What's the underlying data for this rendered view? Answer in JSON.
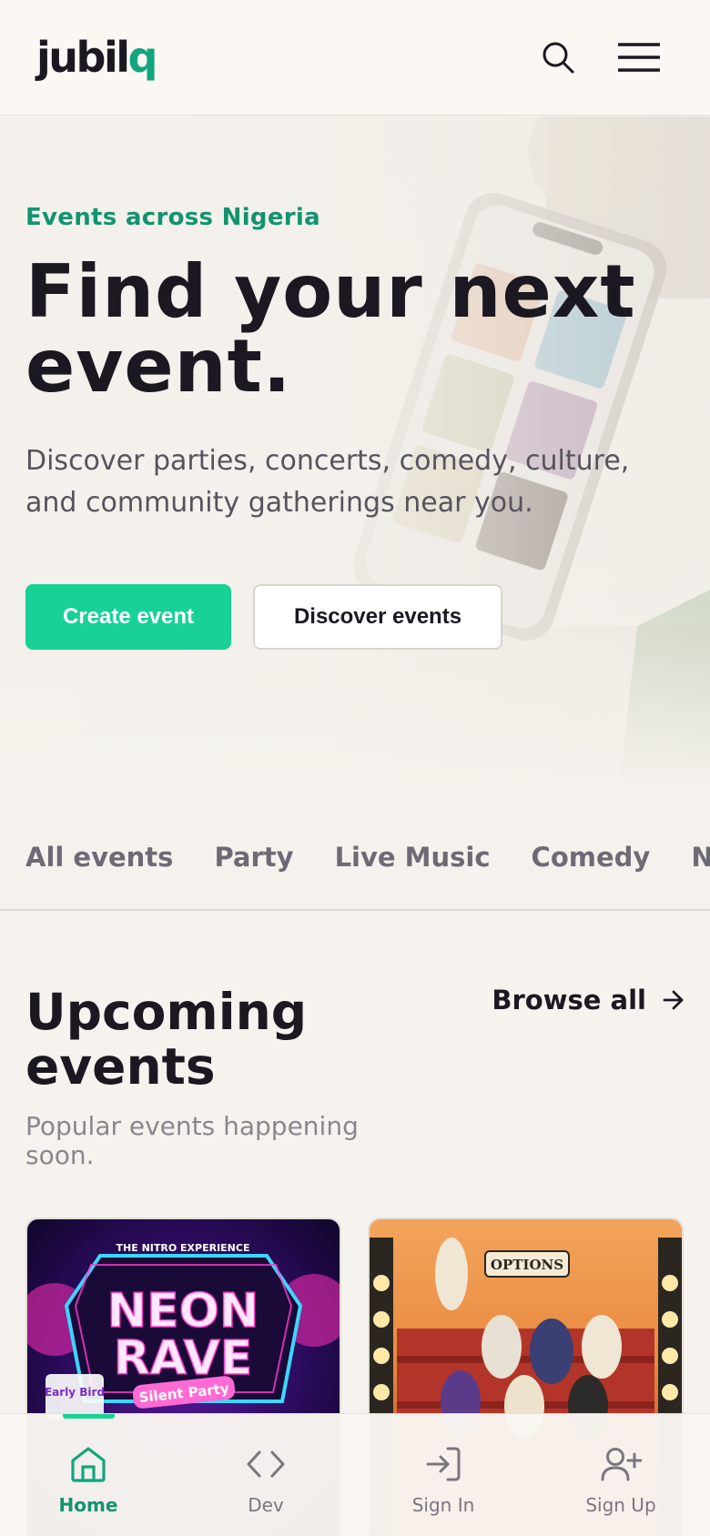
{
  "header": {
    "logo_main": "jubil",
    "logo_accent": "q",
    "search_icon": "search-icon",
    "menu_icon": "hamburger-menu-icon"
  },
  "hero": {
    "eyebrow": "Events across Nigeria",
    "title": "Find your next event.",
    "subtitle": "Discover parties, concerts, comedy, culture, and community gatherings near you.",
    "primary_button": "Create event",
    "secondary_button": "Discover events"
  },
  "categories": {
    "items": [
      "All events",
      "Party",
      "Live Music",
      "Comedy",
      "Nightlife"
    ]
  },
  "upcoming": {
    "title": "Upcoming events",
    "subtitle": "Popular events happening soon.",
    "browse_label": "Browse all",
    "cards": [
      {
        "poster_brand": "THE NITRO EXPERIENCE",
        "poster_title_line1": "NEON",
        "poster_title_line2": "RAVE",
        "poster_tag": "Silent Party",
        "poster_badge": "Early Bird"
      },
      {
        "poster_brand": "OPTIONS"
      }
    ]
  },
  "bottom_nav": {
    "items": [
      {
        "label": "Home",
        "icon": "home-icon",
        "active": true
      },
      {
        "label": "Dev",
        "icon": "code-icon",
        "active": false
      },
      {
        "label": "Sign In",
        "icon": "sign-in-icon",
        "active": false
      },
      {
        "label": "Sign Up",
        "icon": "user-plus-icon",
        "active": false
      }
    ]
  },
  "colors": {
    "accent": "#17d196",
    "accent_text": "#12936f",
    "text_dark": "#1b1822",
    "text_muted": "#6e6a75",
    "background": "#f6f3ee"
  }
}
